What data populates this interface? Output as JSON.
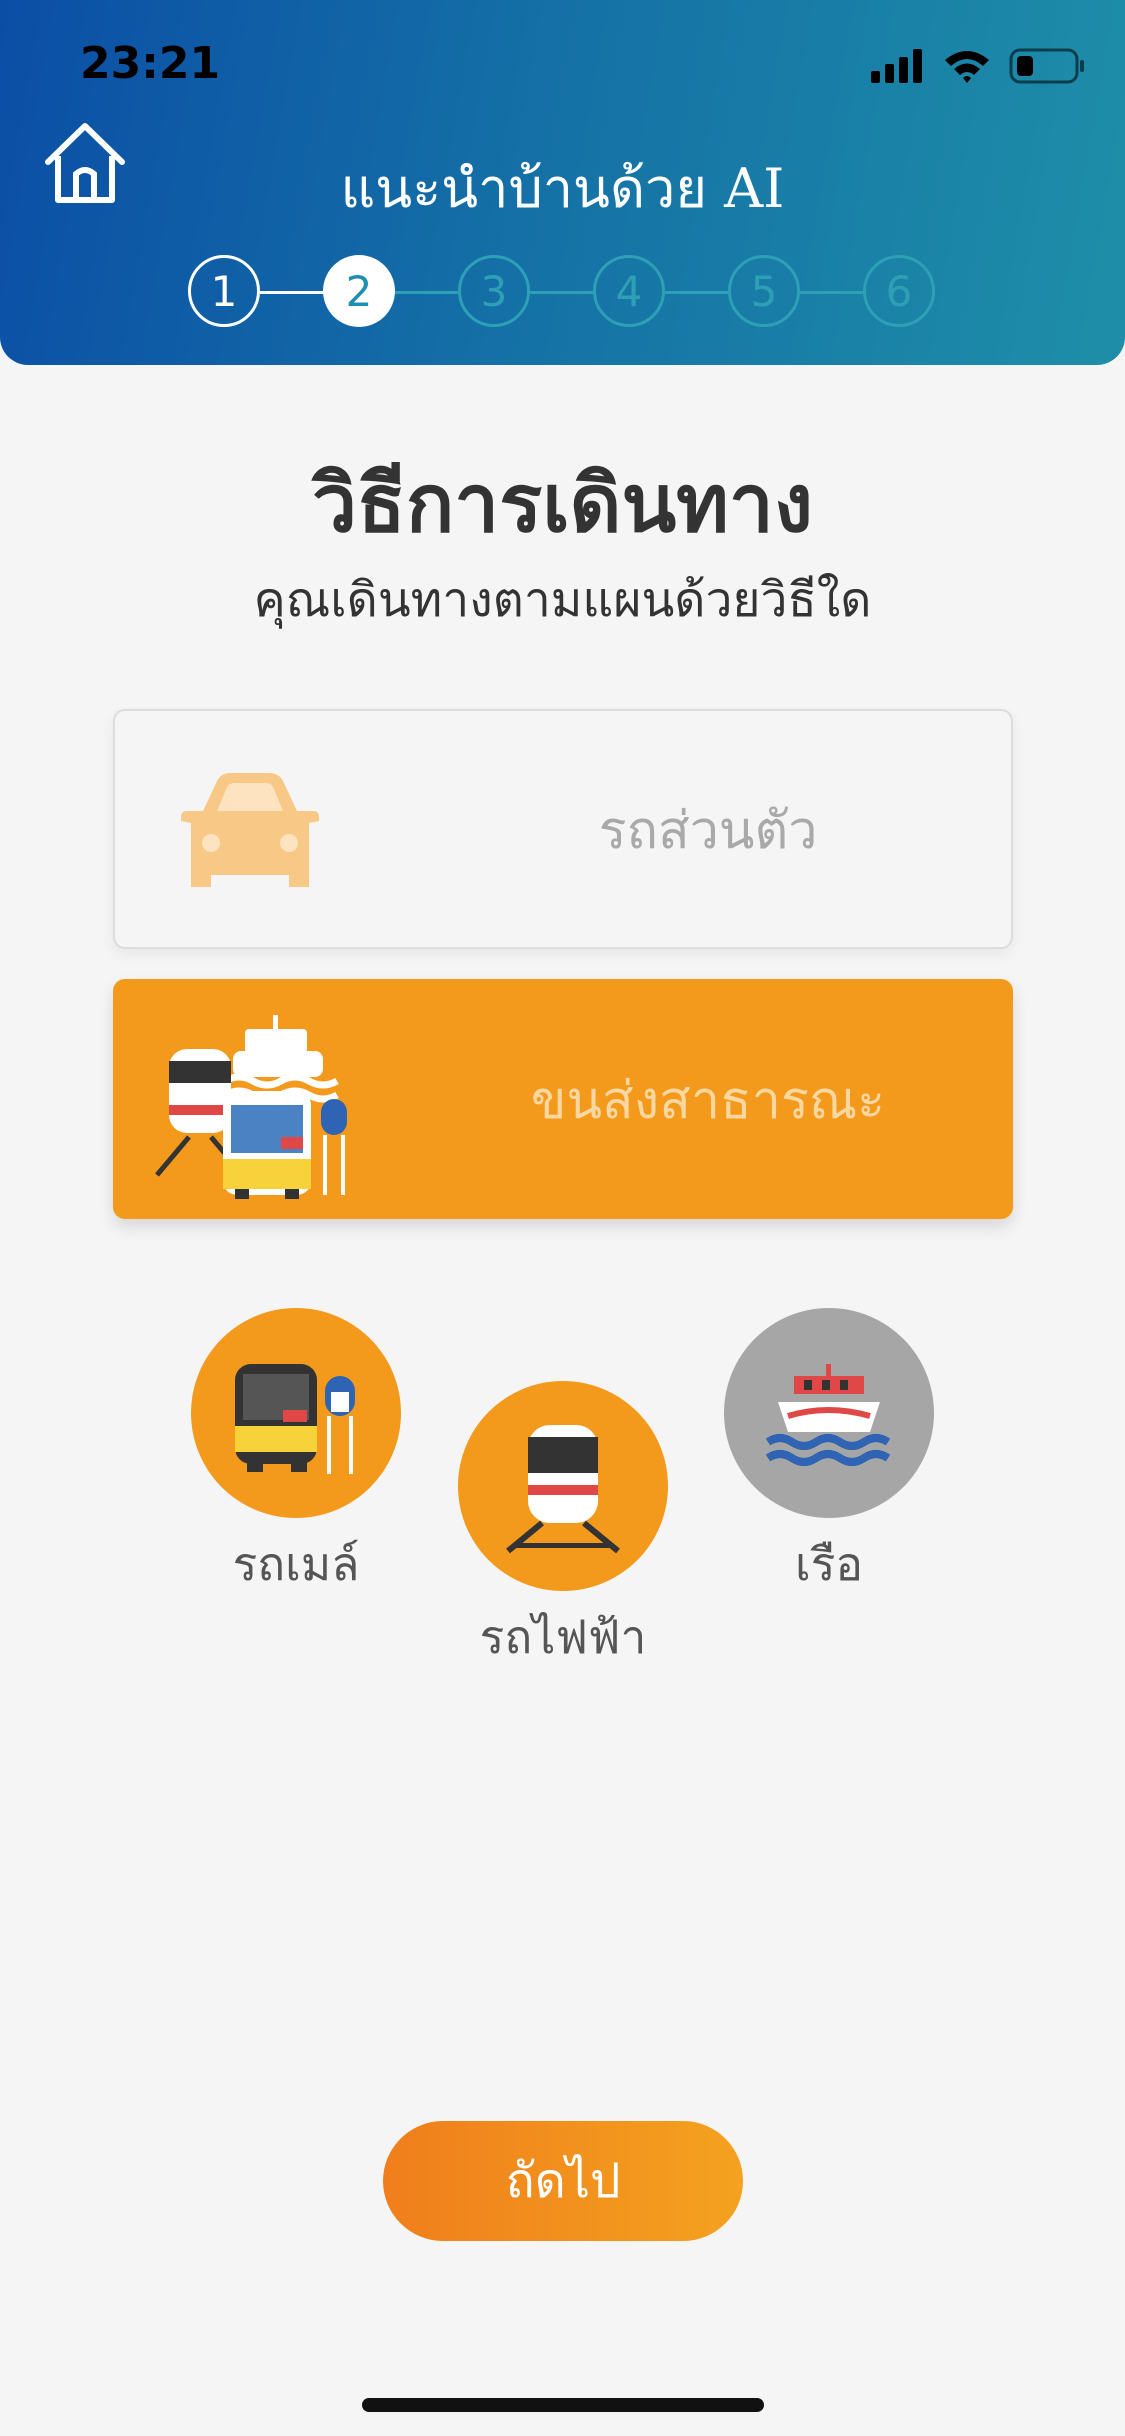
{
  "status_bar": {
    "time": "23:21"
  },
  "header": {
    "title": "แนะนำบ้านด้วย AI"
  },
  "stepper": {
    "current_step": 2,
    "steps": [
      {
        "label": "1",
        "state": "done"
      },
      {
        "label": "2",
        "state": "active"
      },
      {
        "label": "3",
        "state": "future"
      },
      {
        "label": "4",
        "state": "future"
      },
      {
        "label": "5",
        "state": "future"
      },
      {
        "label": "6",
        "state": "future"
      }
    ]
  },
  "main": {
    "heading": "วิธีการเดินทาง",
    "subheading": "คุณเดินทางตามแผนด้วยวิธีใด"
  },
  "options": {
    "private": {
      "label": "รถส่วนตัว",
      "selected": false,
      "icon": "car-icon"
    },
    "public": {
      "label": "ขนส่งสาธารณะ",
      "selected": true,
      "icon": "public-transport-icon"
    }
  },
  "modes": [
    {
      "label": "รถเมล์",
      "selected": true,
      "icon": "bus-icon"
    },
    {
      "label": "รถไฟฟ้า",
      "selected": true,
      "icon": "train-icon"
    },
    {
      "label": "เรือ",
      "selected": false,
      "icon": "boat-icon"
    }
  ],
  "footer": {
    "next_label": "ถัดไป"
  },
  "colors": {
    "accent": "#f39a1d",
    "header_start": "#0b4ea6",
    "header_end": "#1e8fa8",
    "mode_unselected": "#a6a6a6"
  }
}
